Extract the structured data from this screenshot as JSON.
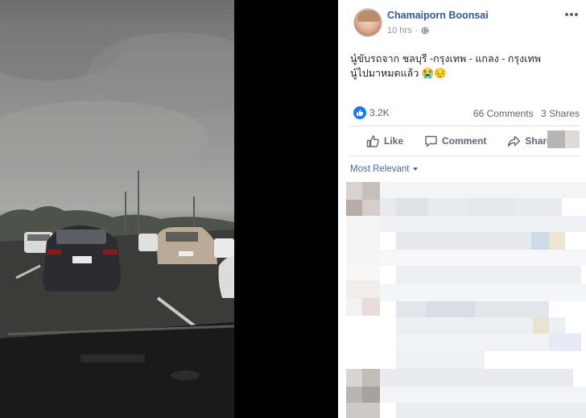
{
  "post": {
    "author": "Chamaiporn Boonsai",
    "time": "10 hrs",
    "privacy_icon": "globe-icon",
    "text_line1": "นู๋ขับรถจาก ชลบุรี -กรุงเทพ - แกลง - กรุงเทพ",
    "text_line2": "นู๋ไปมาหมดแล้ว 😭😔"
  },
  "stats": {
    "likes": "3.2K",
    "comments": "66 Comments",
    "shares": "3 Shares"
  },
  "actions": {
    "like": "Like",
    "comment": "Comment",
    "share": "Share"
  },
  "comments": {
    "sort_label": "Most Relevant"
  },
  "colors": {
    "name_link": "#385898",
    "like_blue": "#1877f2",
    "muted": "#606770"
  }
}
